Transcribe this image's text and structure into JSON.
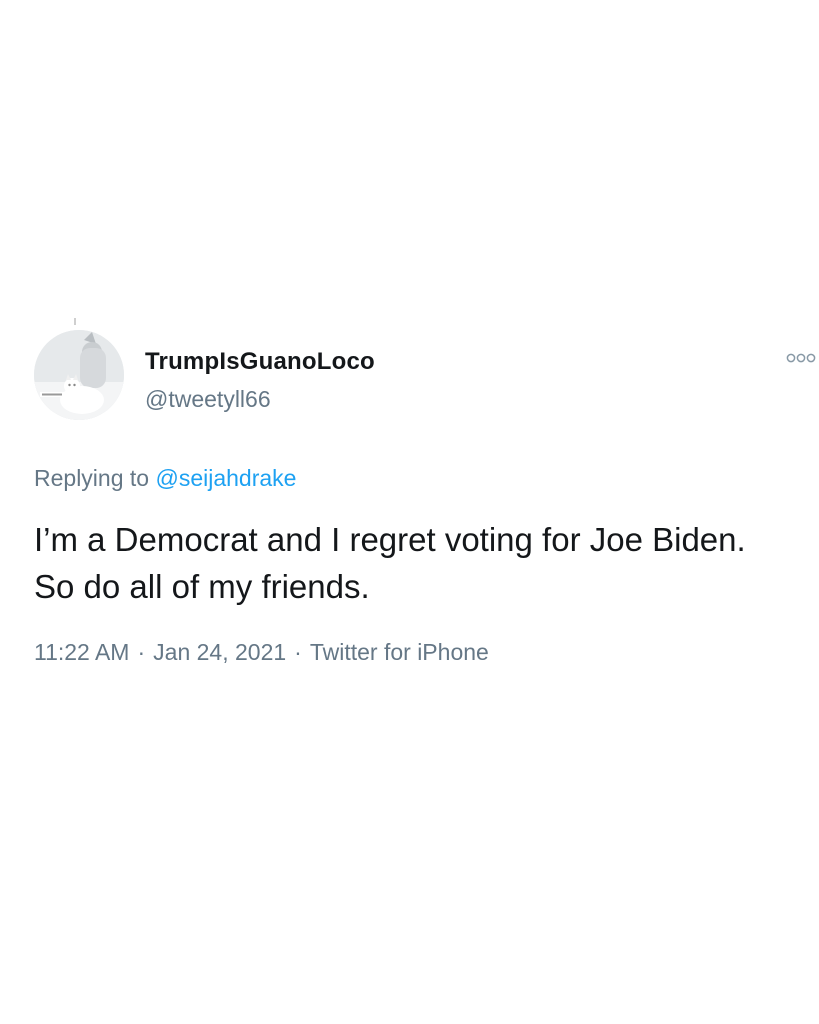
{
  "tweet": {
    "display_name": "TrumpIsGuanoLoco",
    "handle": "@tweetyll66",
    "reply_prefix": "Replying to",
    "reply_mention": "@seijahdrake",
    "text": "I’m a Democrat and I regret voting for Joe Biden. So do all of my friends.",
    "time": "11:22 AM",
    "date": "Jan 24, 2021",
    "source": "Twitter for iPhone",
    "separator": "·",
    "avatar_icon": "avatar-cat-photo",
    "more_icon": "more-options-icon"
  },
  "colors": {
    "text_primary": "#14171a",
    "text_secondary": "#657786",
    "link": "#1da1f2",
    "background": "#ffffff"
  }
}
